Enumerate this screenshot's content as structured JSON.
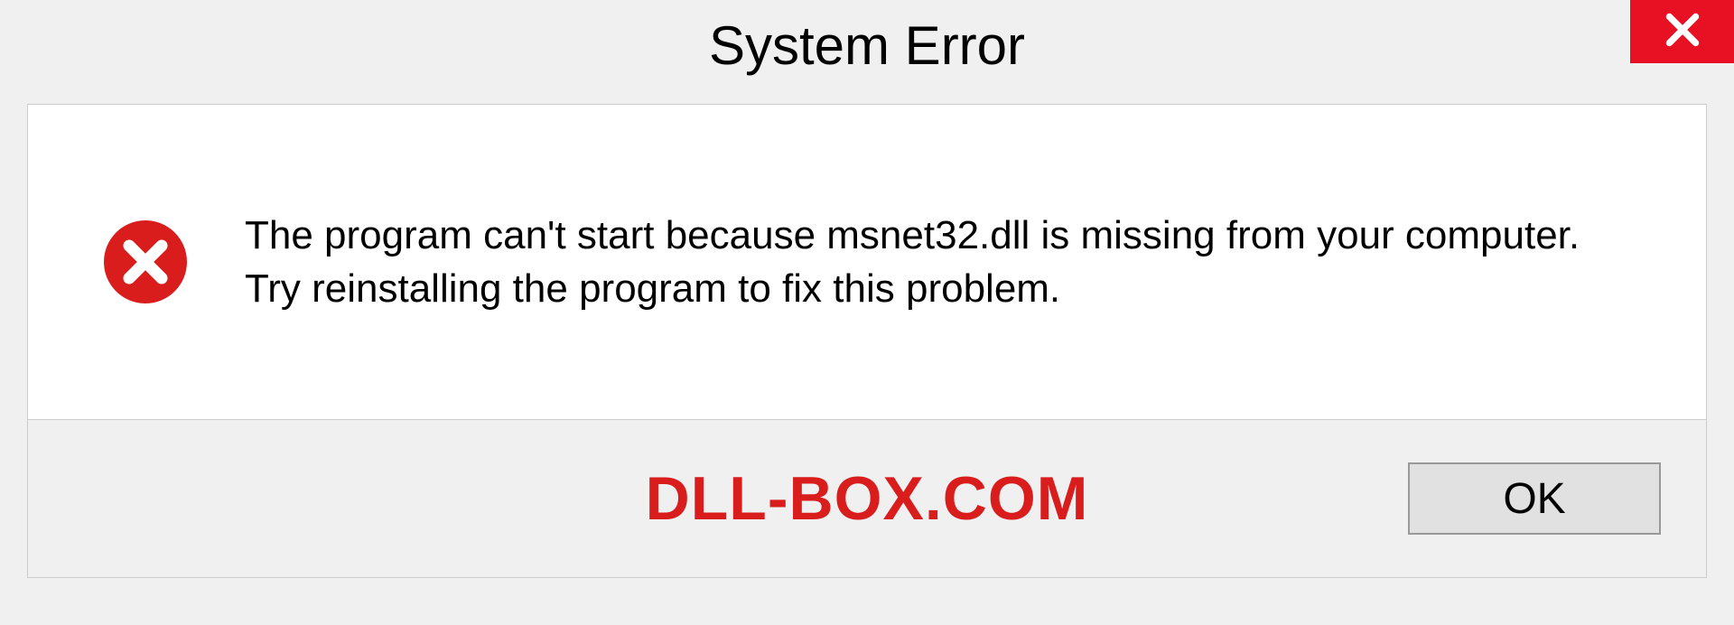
{
  "dialog": {
    "title": "System Error",
    "close_icon": "close-icon",
    "error_icon": "error-circle-x-icon",
    "message": "The program can't start because msnet32.dll is missing from your computer. Try reinstalling the program to fix this problem.",
    "ok_label": "OK"
  },
  "watermark": {
    "text": "DLL-BOX.COM"
  },
  "colors": {
    "close_bg": "#e81123",
    "error_icon": "#d91d1d",
    "watermark": "#d91d1d"
  }
}
